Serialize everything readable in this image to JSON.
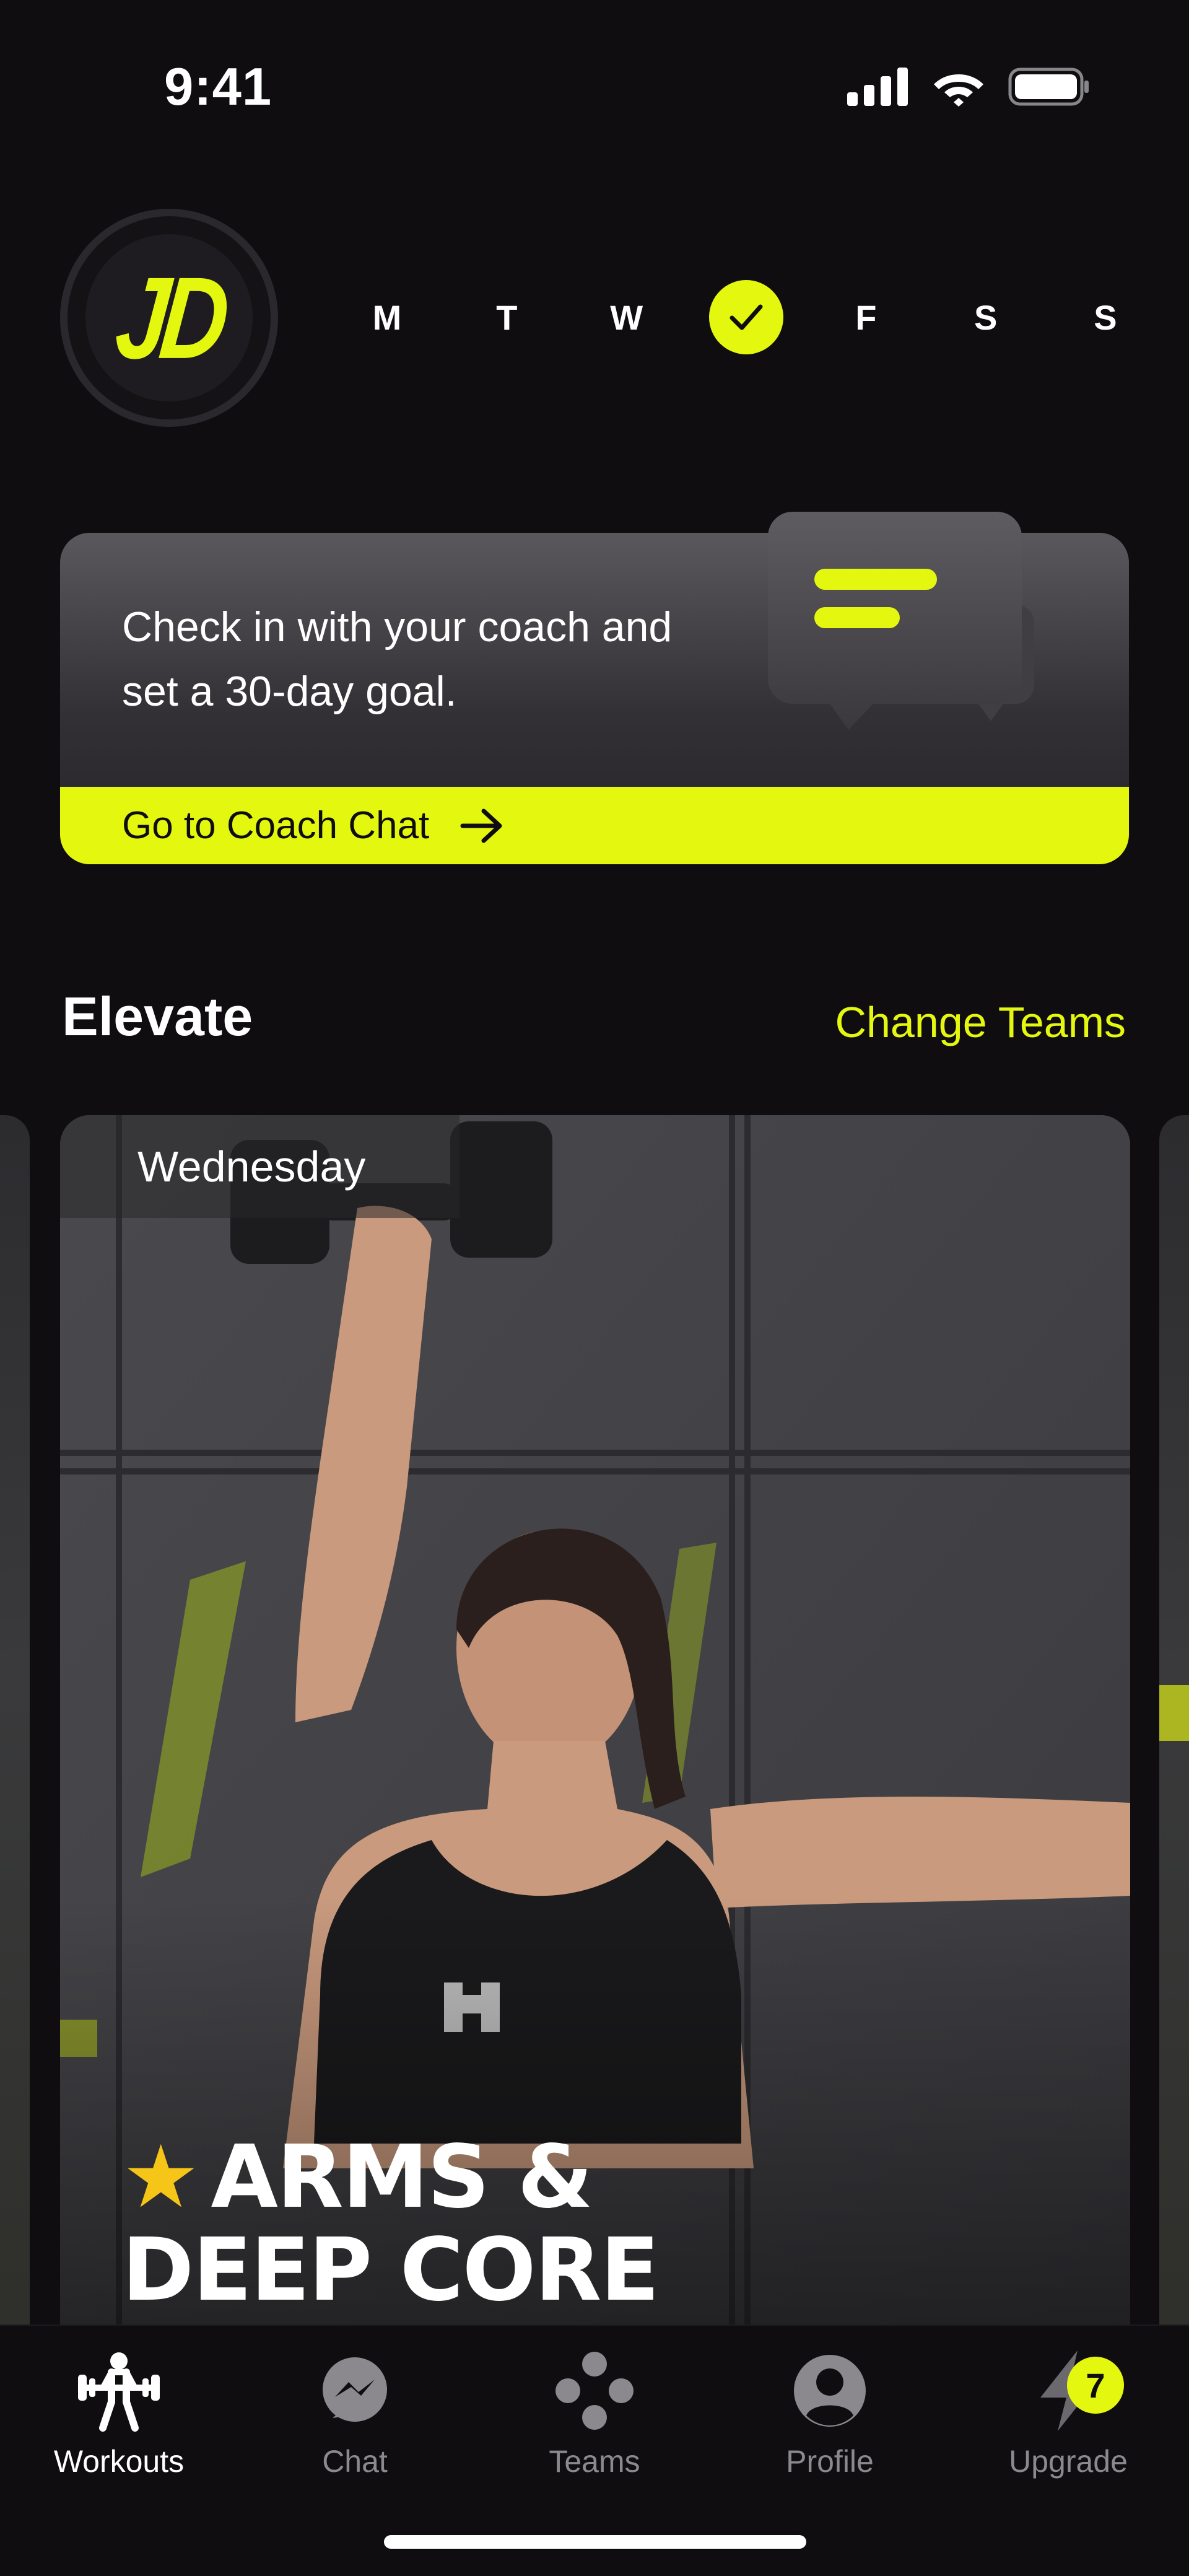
{
  "status_bar": {
    "time": "9:41"
  },
  "avatar": {
    "initials": "JD"
  },
  "week": {
    "days": [
      {
        "label": "M",
        "done": false
      },
      {
        "label": "T",
        "done": false
      },
      {
        "label": "W",
        "done": false
      },
      {
        "label": "",
        "done": true
      },
      {
        "label": "F",
        "done": false
      },
      {
        "label": "S",
        "done": false
      },
      {
        "label": "S",
        "done": false
      }
    ]
  },
  "coach_card": {
    "message_line1": "Check in with your coach and",
    "message_line2": "set a 30-day goal.",
    "cta_label": "Go to Coach Chat"
  },
  "section": {
    "title": "Elevate",
    "link": "Change Teams"
  },
  "workout": {
    "day": "Wednesday",
    "title_line1": "ARMS &",
    "title_line2": "DEEP CORE"
  },
  "tabs": [
    {
      "label": "Workouts",
      "icon": "workouts-icon",
      "active": true
    },
    {
      "label": "Chat",
      "icon": "chat-icon",
      "active": false
    },
    {
      "label": "Teams",
      "icon": "teams-icon",
      "active": false
    },
    {
      "label": "Profile",
      "icon": "profile-icon",
      "active": false
    },
    {
      "label": "Upgrade",
      "icon": "lightning-icon",
      "active": false,
      "badge": "7"
    }
  ],
  "colors": {
    "accent": "#e4f80f",
    "background": "#0f0d10",
    "inactive": "#8b898e"
  }
}
